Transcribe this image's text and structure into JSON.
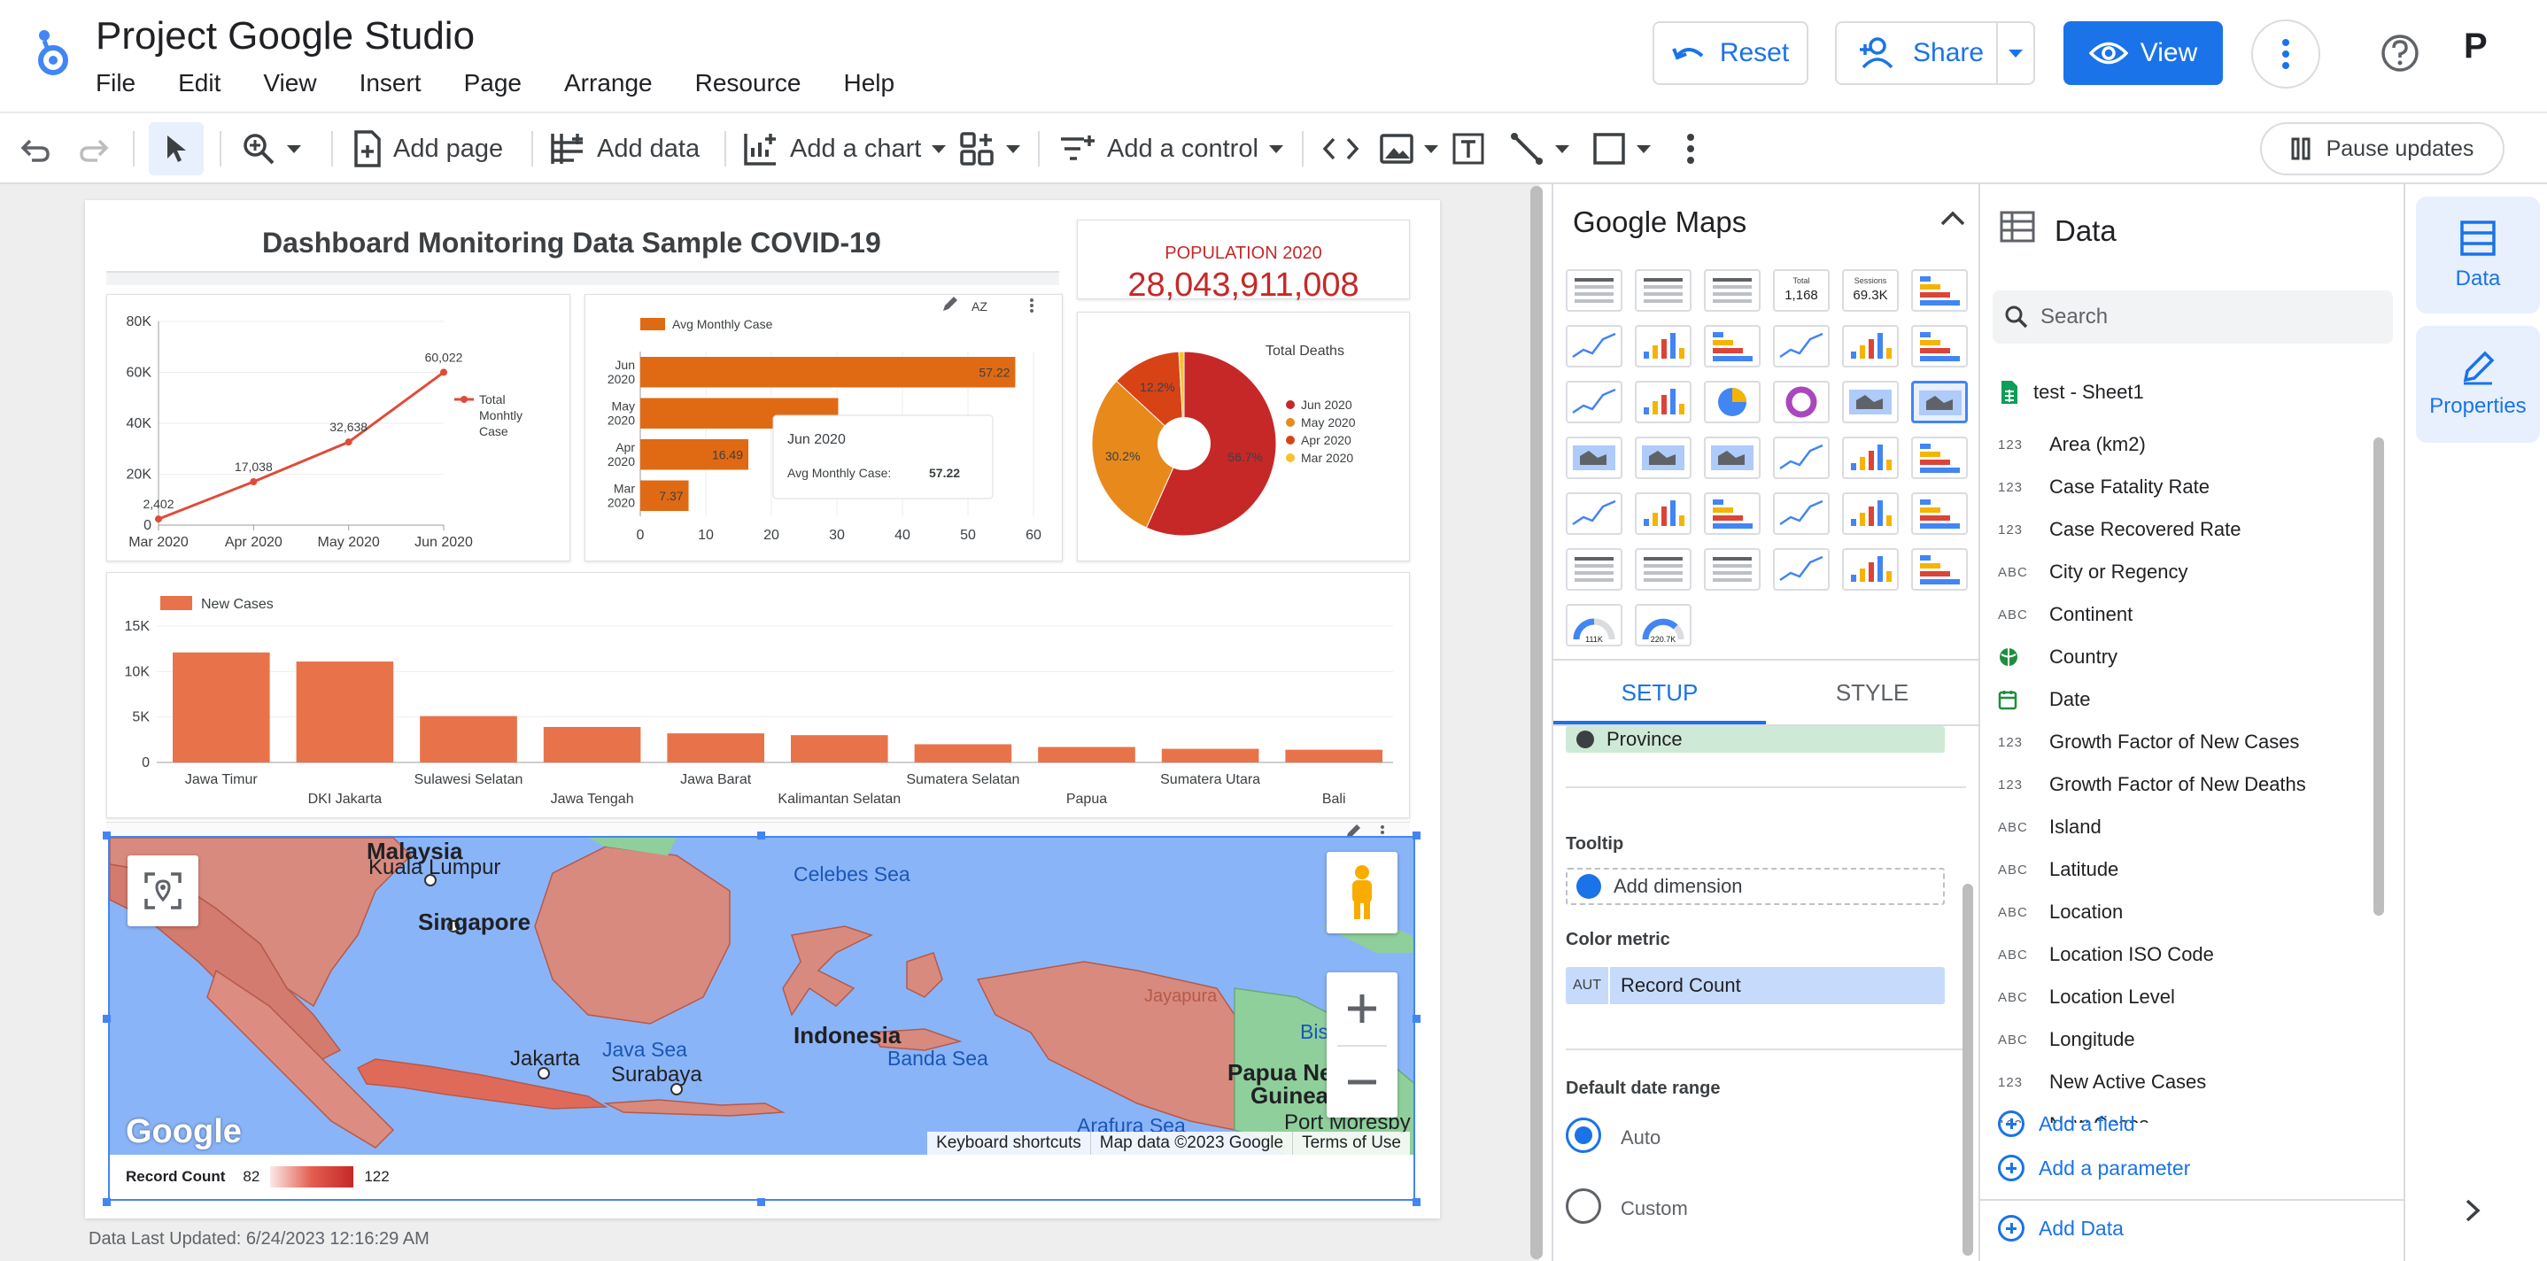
{
  "header": {
    "title": "Project Google Studio",
    "menu": [
      "File",
      "Edit",
      "View",
      "Insert",
      "Page",
      "Arrange",
      "Resource",
      "Help"
    ],
    "reset_label": "Reset",
    "share_label": "Share",
    "view_label": "View",
    "avatar_letter": "P"
  },
  "toolbar": {
    "add_page": "Add page",
    "add_data": "Add data",
    "add_chart": "Add a chart",
    "add_control": "Add a control",
    "pause_updates": "Pause updates"
  },
  "report": {
    "title": "Dashboard Monitoring Data Sample COVID-19",
    "kpi_label": "POPULATION 2020",
    "kpi_value": "28,043,911,008",
    "last_updated": "Data Last Updated: 6/24/2023 12:16:29 AM"
  },
  "chart_data": [
    {
      "type": "line",
      "x": [
        "Mar 2020",
        "Apr 2020",
        "May 2020",
        "Jun 2020"
      ],
      "series": [
        {
          "name": "Total Monhtly Case",
          "values": [
            2402,
            17038,
            32638,
            60022
          ]
        }
      ],
      "data_labels": [
        "2,402",
        "17,038",
        "32,638",
        "60,022"
      ],
      "yticks": [
        "0",
        "20K",
        "40K",
        "60K",
        "80K"
      ],
      "ylim": [
        0,
        80000
      ],
      "legend": "right",
      "color": "#e04b3a"
    },
    {
      "type": "bar",
      "orientation": "horizontal",
      "categories": [
        "Jun 2020",
        "May 2020",
        "Apr 2020",
        "Mar 2020"
      ],
      "series": [
        {
          "name": "Avg Monthly Case",
          "values": [
            57.22,
            30.2,
            16.49,
            7.37
          ]
        }
      ],
      "data_labels": [
        "57.22",
        "",
        "16.49",
        "7.37"
      ],
      "xticks": [
        "0",
        "10",
        "20",
        "30",
        "40",
        "50",
        "60"
      ],
      "xlim": [
        0,
        60
      ],
      "legend": "top",
      "color": "#e06a13",
      "tooltip": {
        "title": "Jun 2020",
        "label": "Avg Monthly Case:",
        "value": "57.22"
      }
    },
    {
      "type": "pie",
      "title": "Total Deaths",
      "categories": [
        "Jun 2020",
        "May 2020",
        "Apr 2020",
        "Mar 2020"
      ],
      "values": [
        56.7,
        30.2,
        12.2,
        0.9
      ],
      "data_labels": [
        "56.7%",
        "30.2%",
        "12.2%",
        ""
      ],
      "colors": [
        "#c62828",
        "#e8891c",
        "#d84315",
        "#fbc02d"
      ],
      "legend": "right"
    },
    {
      "type": "bar",
      "categories": [
        "Jawa Timur",
        "DKI Jakarta",
        "Sulawesi Selatan",
        "Jawa Tengah",
        "Jawa Barat",
        "Kalimantan Selatan",
        "Sumatera Selatan",
        "Papua",
        "Sumatera Utara",
        "Bali"
      ],
      "series": [
        {
          "name": "New Cases",
          "values": [
            12100,
            11100,
            5100,
            3900,
            3200,
            3000,
            2000,
            1700,
            1500,
            1400
          ]
        }
      ],
      "yticks": [
        "0",
        "5K",
        "10K",
        "15K"
      ],
      "ylim": [
        0,
        15000
      ],
      "legend": "top-left",
      "color": "#e8734a"
    }
  ],
  "map": {
    "labels": {
      "malaysia": "Malaysia",
      "kuala_lumpur": "Kuala Lumpur",
      "singapore": "Singapore",
      "celebes_sea": "Celebes Sea",
      "indonesia": "Indonesia",
      "jakarta": "Jakarta",
      "java_sea": "Java Sea",
      "surabaya": "Surabaya",
      "banda_sea": "Banda Sea",
      "jayapura": "Jayapura",
      "bismarck": "Bis",
      "papua_new_guinea_1": "Papua Ne",
      "papua_new_guinea_2": "Guinea",
      "arafura_sea": "Arafura Sea",
      "port_moresby": "Port Moresby"
    },
    "google": "Google",
    "attrib": [
      "Keyboard shortcuts",
      "Map data ©2023 Google",
      "Terms of Use"
    ],
    "legend_label": "Record Count",
    "legend_min": "82",
    "legend_max": "122"
  },
  "chart_panel": {
    "title": "Google Maps",
    "thumb_total_label": "Total",
    "thumb_total_value": "1,168",
    "thumb_sessions_label": "Sessions",
    "thumb_sessions_value": "69.3K",
    "gauge1": "111K",
    "gauge2": "220.7K",
    "tab_setup": "SETUP",
    "tab_style": "STYLE",
    "province": "Province",
    "tooltip_label": "Tooltip",
    "add_dimension": "Add dimension",
    "color_metric_label": "Color metric",
    "metric_type": "AUT",
    "metric_name": "Record Count",
    "date_range_label": "Default date range",
    "auto_label": "Auto",
    "custom_label": "Custom"
  },
  "data_panel": {
    "title": "Data",
    "search_placeholder": "Search",
    "source": "test - Sheet1",
    "fields": [
      {
        "type": "123",
        "name": "Area (km2)"
      },
      {
        "type": "123",
        "name": "Case Fatality Rate"
      },
      {
        "type": "123",
        "name": "Case Recovered Rate"
      },
      {
        "type": "ABC",
        "name": "City or Regency"
      },
      {
        "type": "ABC",
        "name": "Continent"
      },
      {
        "type": "GEO",
        "name": "Country"
      },
      {
        "type": "DATE",
        "name": "Date"
      },
      {
        "type": "123",
        "name": "Growth Factor of New Cases"
      },
      {
        "type": "123",
        "name": "Growth Factor of New Deaths"
      },
      {
        "type": "ABC",
        "name": "Island"
      },
      {
        "type": "ABC",
        "name": "Latitude"
      },
      {
        "type": "ABC",
        "name": "Location"
      },
      {
        "type": "ABC",
        "name": "Location ISO Code"
      },
      {
        "type": "ABC",
        "name": "Location Level"
      },
      {
        "type": "ABC",
        "name": "Longitude"
      },
      {
        "type": "123",
        "name": "New Active Cases"
      },
      {
        "type": "123",
        "name": "New Cases"
      }
    ],
    "add_field": "Add a field",
    "add_parameter": "Add a parameter",
    "add_data": "Add Data"
  },
  "rail": {
    "data_label": "Data",
    "properties_label": "Properties"
  }
}
